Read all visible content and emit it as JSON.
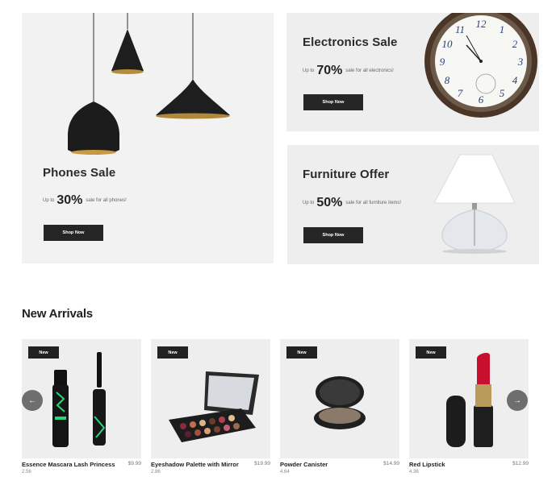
{
  "promos": {
    "phones": {
      "title": "Phones Sale",
      "upto": "Up to",
      "percent": "30%",
      "rest": "sale for all phones!",
      "button": "Shop Now"
    },
    "electronics": {
      "title": "Electronics Sale",
      "upto": "Up to",
      "percent": "70%",
      "rest": "sale for all electronics!",
      "button": "Shop Now"
    },
    "furniture": {
      "title": "Furniture Offer",
      "upto": "Up to",
      "percent": "50%",
      "rest": "sale for all furniture items!",
      "button": "Shop Now"
    }
  },
  "new_arrivals": {
    "title": "New Arrivals",
    "prev_icon": "arrow-left-icon",
    "next_icon": "arrow-right-icon",
    "products": [
      {
        "badge": "New",
        "name": "Essence Mascara Lash Princess",
        "price": "$9.99",
        "rating": "2.56"
      },
      {
        "badge": "New",
        "name": "Eyeshadow Palette with Mirror",
        "price": "$19.99",
        "rating": "2.86"
      },
      {
        "badge": "New",
        "name": "Powder Canister",
        "price": "$14.99",
        "rating": "4.64"
      },
      {
        "badge": "New",
        "name": "Red Lipstick",
        "price": "$12.99",
        "rating": "4.36"
      }
    ]
  },
  "colors": {
    "button_dark": "#262626",
    "panel_bg": "#f2f2f2",
    "card_bg": "#eeeeee",
    "arrow_bg": "#6e6e6e"
  }
}
